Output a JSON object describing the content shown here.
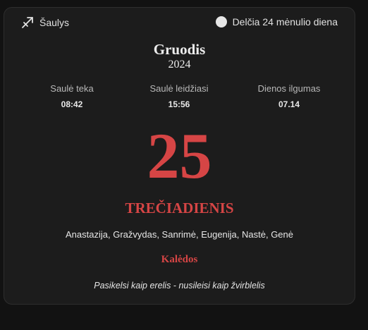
{
  "header": {
    "zodiac_sign": "Šaulys",
    "zodiac_icon": "sagittarius-icon",
    "moon_phase": "Delčia 24 mėnulio diena",
    "moon_icon": "moon-icon"
  },
  "date": {
    "month": "Gruodis",
    "year": "2024",
    "day": "25",
    "weekday": "TREČIADIENIS"
  },
  "sun": {
    "sunrise_label": "Saulė teka",
    "sunrise_value": "08:42",
    "sunset_label": "Saulė leidžiasi",
    "sunset_value": "15:56",
    "daylength_label": "Dienos ilgumas",
    "daylength_value": "07.14"
  },
  "namedays": "Anastazija, Gražvydas, Sanrimė, Eugenija, Nastė, Genė",
  "holiday": "Kalėdos",
  "proverb": "Pasikelsi kaip erelis - nusileisi kaip žvirblelis",
  "colors": {
    "accent": "#d64545",
    "card_bg": "#1c1c1c",
    "page_bg": "#121212"
  }
}
